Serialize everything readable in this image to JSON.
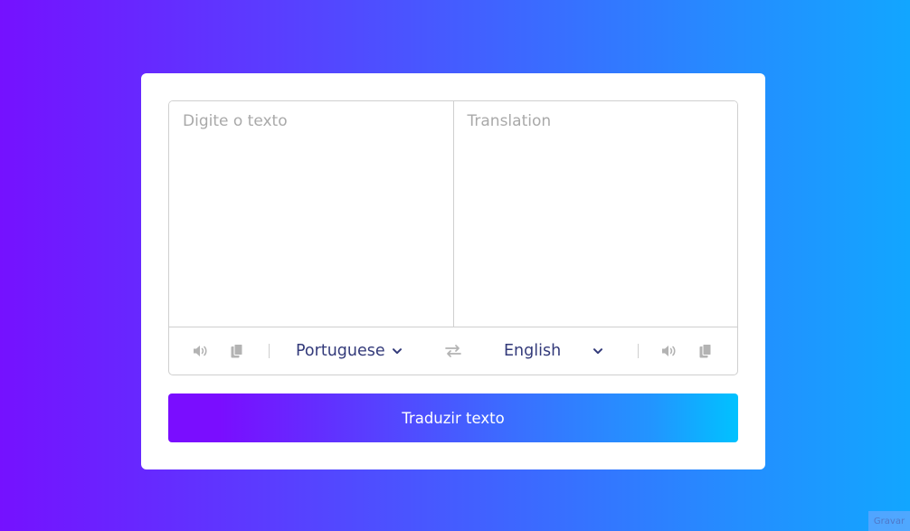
{
  "input": {
    "placeholder": "Digite o texto",
    "value": ""
  },
  "output": {
    "placeholder": "Translation",
    "value": ""
  },
  "controls": {
    "from_language": "Portuguese",
    "to_language": "English",
    "icons": {
      "speak": "volume-icon",
      "copy": "copy-icon",
      "swap": "swap-icon",
      "dropdown": "chevron-down-icon"
    }
  },
  "translate_button": {
    "label": "Traduzir texto"
  },
  "record_widget": {
    "label": "Gravar"
  },
  "colors": {
    "background_start": "#7511ff",
    "background_end": "#12a6ff",
    "language_text": "#333a7a",
    "icon_gray": "#b3b3b3"
  }
}
